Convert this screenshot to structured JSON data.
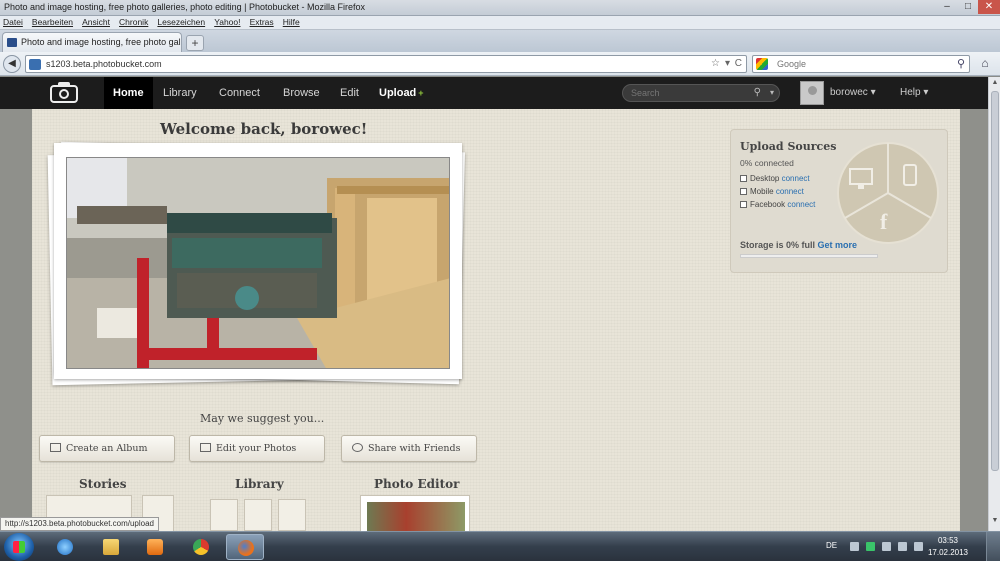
{
  "window": {
    "title": "Photo and image hosting, free photo galleries, photo editing | Photobucket - Mozilla Firefox",
    "minimize": "–",
    "maximize": "□",
    "close": "✕"
  },
  "menu": [
    "Datei",
    "Bearbeiten",
    "Ansicht",
    "Chronik",
    "Lesezeichen",
    "Yahoo!",
    "Extras",
    "Hilfe"
  ],
  "tab": {
    "title": "Photo and image hosting, free photo gal...",
    "new_tab": "+"
  },
  "address": {
    "url": "s1203.beta.photobucket.com",
    "back": "◀",
    "star": "☆",
    "dropdown": "▾",
    "reload": "C"
  },
  "search": {
    "placeholder": "Google",
    "glass": "⚲"
  },
  "home": "⌂",
  "pb": {
    "nav": [
      "Home",
      "Library",
      "Connect",
      "Browse",
      "Edit",
      "Upload"
    ],
    "upload_plus": "+",
    "search_placeholder": "Search",
    "search_glass": "⚲",
    "search_dd": "▾",
    "username": "borowec ▾",
    "help": "Help ▾"
  },
  "main": {
    "welcome": "Welcome back, borowec!",
    "suggest_title": "May we suggest you...",
    "buttons": {
      "album": "Create an Album",
      "edit": "Edit your Photos",
      "share": "Share with Friends"
    },
    "sections": {
      "stories": "Stories",
      "library": "Library",
      "editor": "Photo Editor"
    }
  },
  "upload_sources": {
    "title": "Upload Sources",
    "percent": "0% connected",
    "rows": [
      {
        "label": "Desktop",
        "link": "connect"
      },
      {
        "label": "Mobile",
        "link": "connect"
      },
      {
        "label": "Facebook",
        "link": "connect"
      }
    ],
    "storage": "Storage is 0% full",
    "storage_link": "Get more",
    "storage_fraction": 0,
    "icons": {
      "desktop": "desktop-icon",
      "mobile": "mobile-icon",
      "facebook": "facebook-icon",
      "facebook_glyph": "f"
    }
  },
  "status_url": "http://s1203.beta.photobucket.com/upload",
  "taskbar": {
    "lang": "DE",
    "time": "03:53",
    "date": "17.02.2013",
    "apps": [
      "internet-explorer-icon",
      "explorer-folder-icon",
      "media-player-icon",
      "chrome-icon",
      "firefox-icon"
    ]
  },
  "colors": {
    "accent_link": "#2a6fb0",
    "upload_plus": "#8fc43c",
    "header_bg": "#1c1c1c"
  }
}
